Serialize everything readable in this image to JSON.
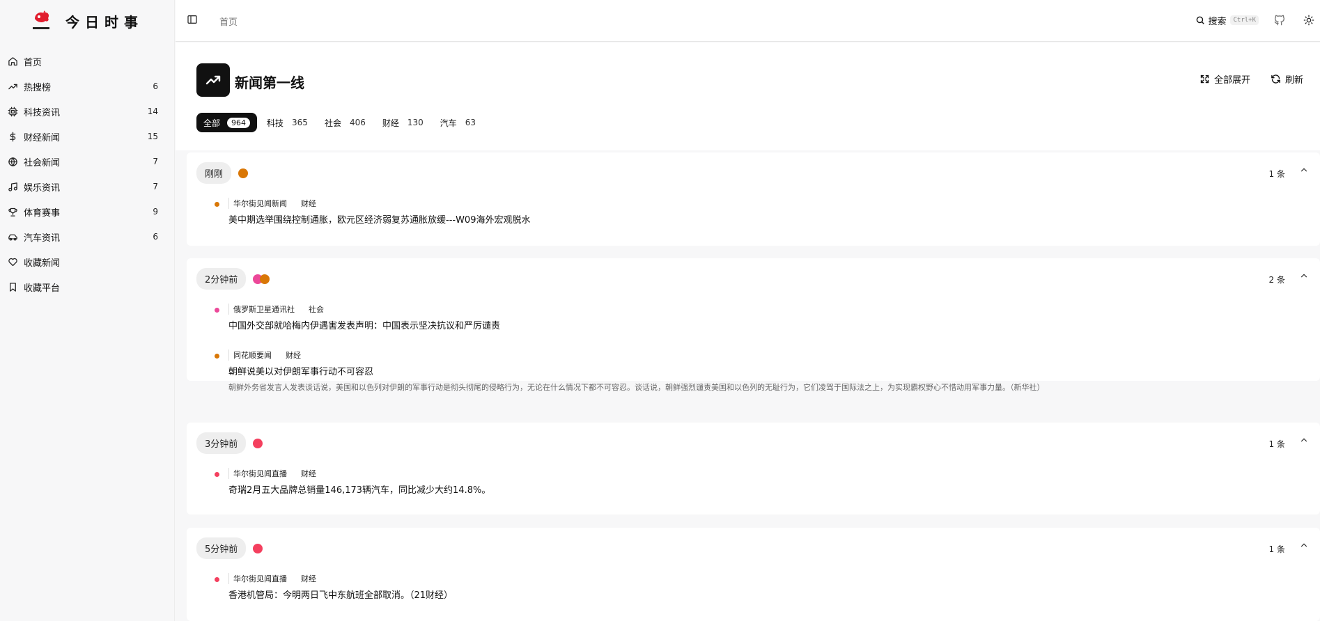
{
  "brand": {
    "logo_text": "今日时事",
    "title": "今日时事"
  },
  "nav": {
    "items": [
      {
        "label": "首页",
        "count": "",
        "icon": "home-icon"
      },
      {
        "label": "热搜榜",
        "count": "6",
        "icon": "trending-icon"
      },
      {
        "label": "科技资讯",
        "count": "14",
        "icon": "cpu-icon"
      },
      {
        "label": "财经新闻",
        "count": "15",
        "icon": "dollar-icon"
      },
      {
        "label": "社会新闻",
        "count": "7",
        "icon": "globe-icon"
      },
      {
        "label": "娱乐资讯",
        "count": "7",
        "icon": "music-icon"
      },
      {
        "label": "体育赛事",
        "count": "9",
        "icon": "trophy-icon"
      },
      {
        "label": "汽车资讯",
        "count": "6",
        "icon": "car-icon"
      },
      {
        "label": "收藏新闻",
        "count": "",
        "icon": "heart-icon"
      },
      {
        "label": "收藏平台",
        "count": "",
        "icon": "bookmark-icon"
      }
    ]
  },
  "header": {
    "breadcrumb": "首页",
    "search_label": "搜索",
    "search_shortcut": "Ctrl+K"
  },
  "page": {
    "title": "新闻第一线",
    "expand_label": "全部展开",
    "refresh_label": "刷新",
    "categories": [
      {
        "label": "全部",
        "count": "964"
      },
      {
        "label": "科技",
        "count": "365"
      },
      {
        "label": "社会",
        "count": "406"
      },
      {
        "label": "财经",
        "count": "130"
      },
      {
        "label": "汽车",
        "count": "63"
      }
    ]
  },
  "groups": [
    {
      "time": "刚刚",
      "count": "1 条",
      "items": [
        {
          "source": "华尔街见闻新闻",
          "tag": "财经",
          "title": "美中期选举围绕控制通胀，欧元区经济弱复苏通胀放缓---W09海外宏观脱水",
          "desc": ""
        }
      ]
    },
    {
      "time": "2分钟前",
      "count": "2 条",
      "items": [
        {
          "source": "俄罗斯卫星通讯社",
          "tag": "社会",
          "title": "中国外交部就哈梅内伊遇害发表声明：中国表示坚决抗议和严厉谴责",
          "desc": ""
        },
        {
          "source": "同花顺要闻",
          "tag": "财经",
          "title": "朝鲜说美以对伊朗军事行动不可容忍",
          "desc": "朝鲜外务省发言人发表谈话说，美国和以色列对伊朗的军事行动是彻头彻尾的侵略行为，无论在什么情况下都不可容忍。谈话说，朝鲜强烈谴责美国和以色列的无耻行为，它们凌驾于国际法之上，为实现霸权野心不惜动用军事力量。（新华社）"
        }
      ]
    },
    {
      "time": "3分钟前",
      "count": "1 条",
      "items": [
        {
          "source": "华尔街见闻直播",
          "tag": "财经",
          "title": "奇瑞2月五大品牌总销量146,173辆汽车，同比减少大约14.8%。",
          "desc": ""
        }
      ]
    },
    {
      "time": "5分钟前",
      "count": "1 条",
      "items": [
        {
          "source": "华尔街见闻直播",
          "tag": "财经",
          "title": "香港机管局：今明两日飞中东航班全部取消。（21财经）",
          "desc": ""
        }
      ]
    }
  ],
  "colors": {
    "orange": "#d97706",
    "pink": "#ec4899",
    "red": "#f43f5e",
    "active": "#111111"
  }
}
